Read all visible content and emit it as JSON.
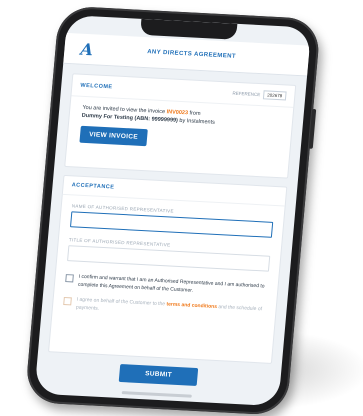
{
  "header": {
    "logo": "A",
    "title": "ANY DIRECTS AGREEMENT"
  },
  "welcome": {
    "section_title": "WELCOME",
    "reference_label": "REFERENCE",
    "reference_value": "202678",
    "intro_text": "You are invited to view the invoice ",
    "invoice_ref": "INV0023",
    "from_text": " from",
    "company": "Dummy For Testing (ABN: 99999999)",
    "company_suffix": " by Instalments",
    "view_button": "VIEW INVOICE"
  },
  "acceptance": {
    "section_title": "ACCEPTANCE",
    "name_label": "NAME OF AUTHORISED REPRESENTATIVE",
    "name_value": "",
    "title_label": "TITLE OF AUTHORISED REPRESENTATIVE",
    "title_value": "",
    "confirm_text": "I confirm and warrant that I am an Authorised Representative and I am authorised to complete this Agreement on behalf of the Customer.",
    "agree_prefix": "I agree on behalf of the Customer to the ",
    "agree_link": "terms and conditions",
    "agree_suffix": " and the schedule of payments."
  },
  "submit": {
    "label": "SUBMIT"
  },
  "colors": {
    "brand_blue": "#1f6fb8",
    "accent_orange": "#f07a1c",
    "phone_body": "#1c1c1e",
    "screen_bg": "#eef2f6"
  }
}
